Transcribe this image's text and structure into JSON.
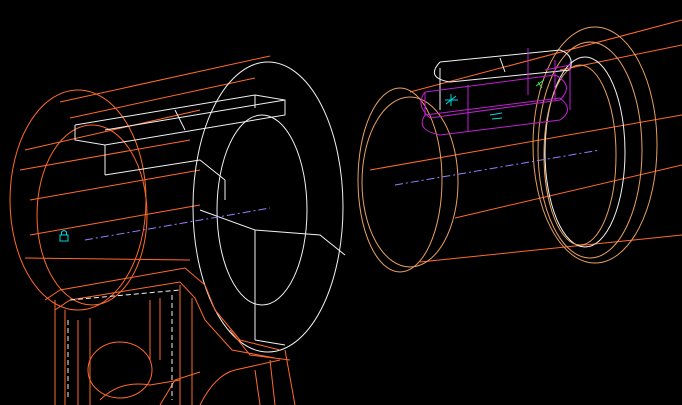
{
  "viewport": {
    "background": "#000000",
    "colors": {
      "edge_orange": "#ff6a2a",
      "edge_white": "#f2f2f2",
      "edge_tan": "#e8a060",
      "edge_magenta": "#c020d0",
      "centerline_violet": "#9a7cff",
      "marker_cyan": "#00d8e0",
      "marker_green": "#40e060"
    }
  },
  "parts": [
    {
      "name": "housing",
      "edge_color": "orange"
    },
    {
      "name": "shaft-with-keyway",
      "edge_color": "tan"
    }
  ],
  "markers": [
    {
      "name": "lock-icon",
      "icon": "lock"
    },
    {
      "name": "keyway-axis-marker",
      "icon": "crosshair"
    },
    {
      "name": "keyway-dimension-marker",
      "icon": "dimension"
    }
  ]
}
